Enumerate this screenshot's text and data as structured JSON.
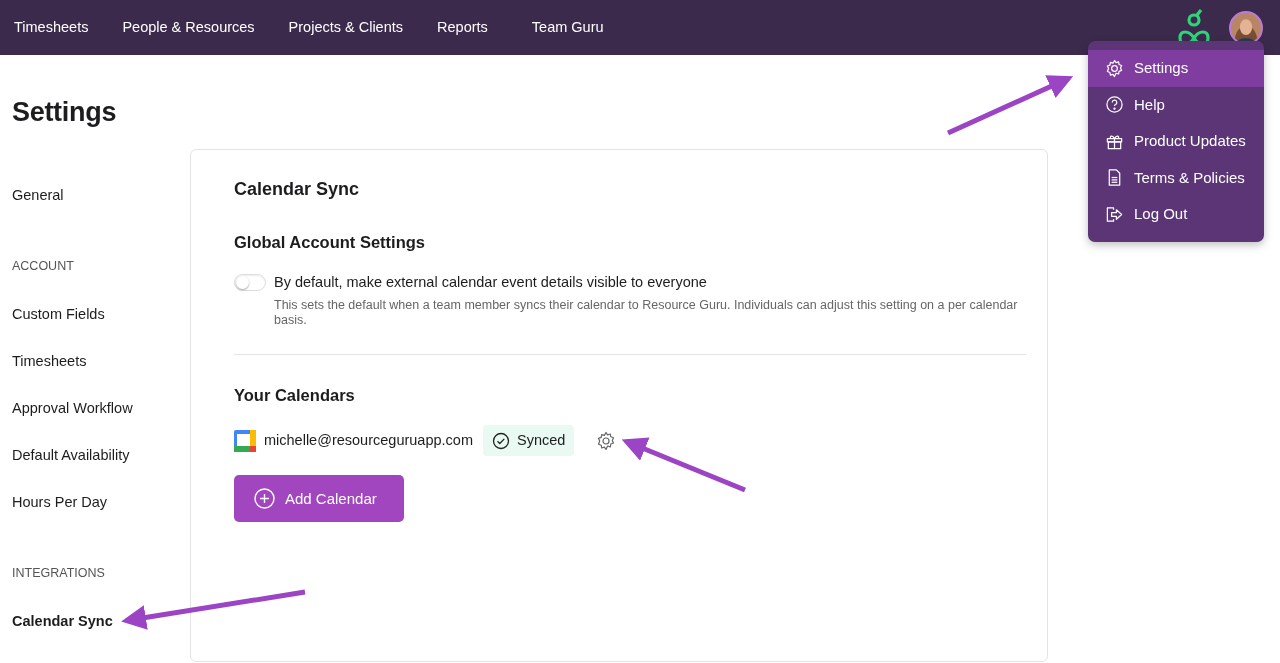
{
  "nav": {
    "items": [
      {
        "label": "Timesheets"
      },
      {
        "label": "People & Resources"
      },
      {
        "label": "Projects & Clients"
      },
      {
        "label": "Reports"
      },
      {
        "label": "Team Guru"
      }
    ]
  },
  "user_menu": {
    "items": [
      {
        "label": "Settings",
        "selected": true
      },
      {
        "label": "Help",
        "selected": false
      },
      {
        "label": "Product Updates",
        "selected": false
      },
      {
        "label": "Terms & Policies",
        "selected": false
      },
      {
        "label": "Log Out",
        "selected": false
      }
    ]
  },
  "page_title": "Settings",
  "sidebar": {
    "sections": [
      {
        "items": [
          {
            "label": "General",
            "selected": false
          }
        ]
      },
      {
        "heading": "ACCOUNT",
        "items": [
          {
            "label": "Custom Fields",
            "selected": false
          },
          {
            "label": "Timesheets",
            "selected": false
          },
          {
            "label": "Approval Workflow",
            "selected": false
          },
          {
            "label": "Default Availability",
            "selected": false
          },
          {
            "label": "Hours Per Day",
            "selected": false
          }
        ]
      },
      {
        "heading": "INTEGRATIONS",
        "items": [
          {
            "label": "Calendar Sync",
            "selected": true
          }
        ]
      }
    ]
  },
  "panel": {
    "title": "Calendar Sync",
    "global_settings": {
      "heading": "Global Account Settings",
      "toggle": {
        "label": "By default, make external calendar event details visible to everyone",
        "on": false,
        "help": "This sets the default when a team member syncs their calendar to Resource Guru. Individuals can adjust this setting on a per calendar basis."
      }
    },
    "calendars": {
      "heading": "Your Calendars",
      "items": [
        {
          "email": "michelle@resourceguruapp.com",
          "status": "Synced"
        }
      ],
      "add_button": "Add Calendar"
    }
  }
}
